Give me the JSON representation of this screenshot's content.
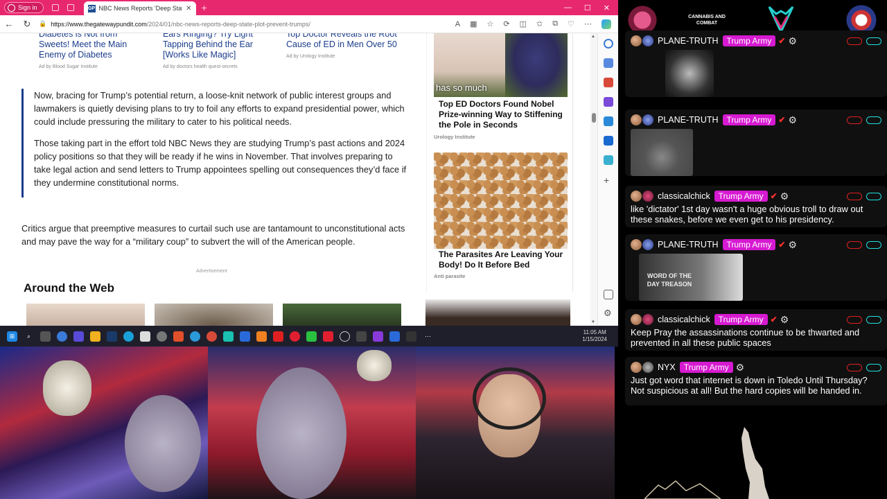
{
  "browser": {
    "sign_in": "Sign in",
    "tab_title": "NBC News Reports 'Deep State' P",
    "tab_favicon": "GP",
    "url_domain": "https://www.thegatewaypundit.com",
    "url_path": "/2024/01/nbc-news-reports-deep-state-plot-prevent-trumps/"
  },
  "ads": [
    {
      "title": "Diabetes is Not from Sweets! Meet the Main Enemy of Diabetes",
      "source": "Ad by Blood Sugar Institute"
    },
    {
      "title": "Ears Ringing? Try Light Tapping Behind the Ear [Works Like Magic]",
      "source": "Ad by doctors health quest-secrets"
    },
    {
      "title": "Top Doctor Reveals the Root Cause of ED in Men Over 50",
      "source": "Ad by Urology Institute"
    }
  ],
  "article": {
    "quote_p1": "Now, bracing for Trump’s potential return, a loose-knit network of public interest groups and lawmakers is quietly devising plans to try to foil any efforts to expand presidential power, which could include pressuring the military to cater to his political needs.",
    "quote_p2": "Those taking part in the effort told NBC News they are studying Trump’s past actions and 2024 policy positions so that they will be ready if he wins in November. That involves preparing to take legal action and send letters to Trump appointees spelling out consequences they’d face if they undermine constitutional norms.",
    "critics": "Critics argue that preemptive measures to curtail such use are tantamount to unconstitutional acts and may pave the way for a “military coup” to subvert the will of the American people.",
    "advertisement_label": "Advertisement",
    "around_the_web": "Around the Web"
  },
  "right_ads": [
    {
      "caption": "has so much",
      "title": "Top ED Doctors Found Nobel Prize-winning Way to Stiffening the Pole in Seconds",
      "source": "Urology Institute"
    },
    {
      "title": "The Parasites Are Leaving Your Body! Do It Before Bed",
      "source": "Anti parasite"
    }
  ],
  "taskbar": {
    "time": "11:05 AM",
    "date": "1/15/2024"
  },
  "logos": {
    "logo2": "CANNABIS AND COMBAT"
  },
  "chat": [
    {
      "user": "PLANE-TRUTH",
      "badge": "Trump Army",
      "text": ""
    },
    {
      "user": "PLANE-TRUTH",
      "badge": "Trump Army",
      "text": ""
    },
    {
      "user": "classicalchick",
      "badge": "Trump Army",
      "text": "like 'dictator' 1st day wasn't a huge obvious troll to draw out these snakes, before we even get to his presidency."
    },
    {
      "user": "PLANE-TRUTH",
      "badge": "Trump Army",
      "text": "",
      "image_caption": "WORD OF THE DAY TREASON"
    },
    {
      "user": "classicalchick",
      "badge": "Trump Army",
      "text": "Keep Pray the assassinations continue to be thwarted and prevented in all these public spaces"
    },
    {
      "user": "NYX",
      "badge": "Trump Army",
      "text": "Just got word that internet is down in Toledo Until Thursday? Not suspicious at all! But the hard copies will be handed in."
    }
  ],
  "colors": {
    "tabbar": "#e8286e",
    "badge": "#d61ad1",
    "link": "#1a3c8c",
    "chat_bg": "#101010"
  }
}
